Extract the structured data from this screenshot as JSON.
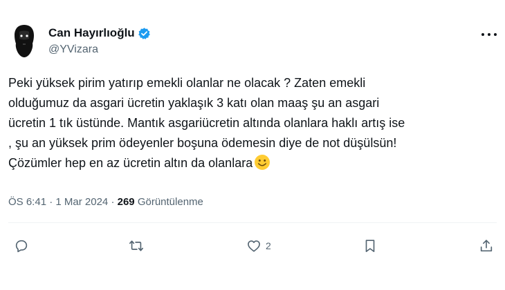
{
  "author": {
    "display_name": "Can Hayırlıoğlu",
    "handle": "@YVizara",
    "verified": true,
    "avatar_icon": "bearded-man-silhouette"
  },
  "tweet": {
    "text": "Peki yüksek pirim yatırıp emekli olanlar ne olacak ? Zaten emekli\nolduğumuz da asgari ücretin yaklaşık 3 katı olan maaş şu an asgari\nücretin  1 tık üstünde. Mantık asgariücretin altında olanlara haklı artış ise\n, şu an yüksek prim ödeyenler boşuna ödemesin diye de not düşülsün!\nÇözümler hep en az ücretin altın da olanlara",
    "emoji": "smiling-face-emoji"
  },
  "meta": {
    "time": "ÖS 6:41",
    "separator": "·",
    "date": "1 Mar 2024",
    "views_count": "269",
    "views_label": "Görüntülenme"
  },
  "actions": {
    "reply_count": "",
    "retweet_count": "",
    "like_count": "2",
    "bookmark_count": ""
  },
  "colors": {
    "text": "#0f1419",
    "muted": "#536471",
    "verified": "#1d9bf0",
    "divider": "#eff3f4"
  }
}
